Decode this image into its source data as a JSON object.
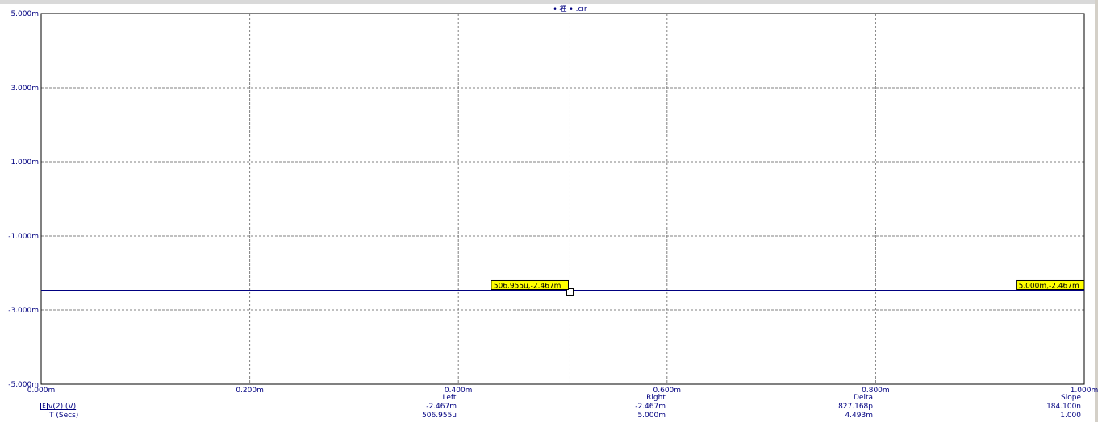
{
  "window": {
    "title": "• 裡 • .cir"
  },
  "chart_data": {
    "type": "line",
    "title": "• 裡 • .cir",
    "xlim": [
      0,
      0.001
    ],
    "ylim": [
      -0.005,
      0.005
    ],
    "x_ticks": [
      {
        "value": 0.0,
        "label": "0.000m"
      },
      {
        "value": 0.0002,
        "label": "0.200m"
      },
      {
        "value": 0.0004,
        "label": "0.400m"
      },
      {
        "value": 0.0006,
        "label": "0.600m"
      },
      {
        "value": 0.0008,
        "label": "0.800m"
      },
      {
        "value": 0.001,
        "label": "1.000m"
      }
    ],
    "y_ticks": [
      {
        "value": 0.005,
        "label": "5.000m"
      },
      {
        "value": 0.003,
        "label": "3.000m"
      },
      {
        "value": 0.001,
        "label": "1.000m"
      },
      {
        "value": -0.001,
        "label": "-1.000m"
      },
      {
        "value": -0.003,
        "label": "-3.000m"
      },
      {
        "value": -0.005,
        "label": "-5.000m"
      }
    ],
    "grid": true,
    "series": [
      {
        "name": "v(2) (V)",
        "color": "#000080",
        "x": [
          0,
          0.001
        ],
        "y": [
          -0.002467,
          -0.002467
        ]
      }
    ],
    "cursors": [
      {
        "x": 0.000506955,
        "y": -0.002467,
        "label": "506.955u,-2.467m",
        "vertical_line": true
      },
      {
        "x": 0.005,
        "y": -0.002467,
        "label": "5.000m,-2.467m",
        "vertical_line": false
      }
    ],
    "readout": {
      "headers": {
        "left": "Left",
        "right": "Right",
        "delta": "Delta",
        "slope": "Slope"
      },
      "trace_marker": "E",
      "trace_label": "v(2) (V)",
      "trace_values": {
        "left": "-2.467m",
        "right": "-2.467m",
        "delta": "827.168p",
        "slope": "184.100n"
      },
      "x_label": "T (Secs)",
      "x_values": {
        "left": "506.955u",
        "right": "5.000m",
        "delta": "4.493m",
        "slope": "1.000"
      }
    }
  }
}
